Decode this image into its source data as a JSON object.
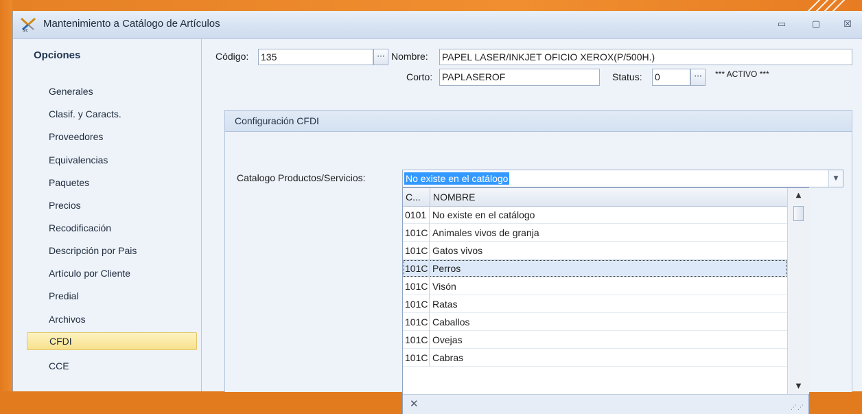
{
  "window": {
    "title": "Mantenimiento a Catálogo de Artículos",
    "buttons": {
      "minimize": "▭",
      "restore": "▢",
      "close": "☒"
    }
  },
  "sidebar": {
    "title": "Opciones",
    "items": [
      {
        "label": "Generales"
      },
      {
        "label": "Clasif. y Caracts."
      },
      {
        "label": "Proveedores"
      },
      {
        "label": "Equivalencias"
      },
      {
        "label": "Paquetes"
      },
      {
        "label": "Precios"
      },
      {
        "label": "Recodificación"
      },
      {
        "label": "Descripción por Pais"
      },
      {
        "label": "Artículo por Cliente"
      },
      {
        "label": "Predial"
      },
      {
        "label": "Archivos"
      },
      {
        "label": "CFDI",
        "active": true
      },
      {
        "label": "CCE"
      }
    ]
  },
  "form": {
    "codigo_label": "Código:",
    "codigo_value": "135",
    "nombre_label": "Nombre:",
    "nombre_value": "PAPEL LASER/INKJET OFICIO XEROX(P/500H.)",
    "corto_label": "Corto:",
    "corto_value": "PAPLASEROF",
    "status_label": "Status:",
    "status_value": "0",
    "status_text": "*** ACTIVO ***",
    "ellipsis": "···"
  },
  "cfdi": {
    "group_title": "Configuración CFDI",
    "catalog_label": "Catalogo Productos/Servicios:",
    "catalog_selected": "No existe en el catálogo",
    "columns": {
      "code": "C...",
      "name": "NOMBRE"
    },
    "rows": [
      {
        "code": "0101",
        "name": "No existe en el catálogo"
      },
      {
        "code": "101C",
        "name": "Animales vivos de granja"
      },
      {
        "code": "101C",
        "name": "Gatos vivos"
      },
      {
        "code": "101C",
        "name": "Perros",
        "highlighted": true
      },
      {
        "code": "101C",
        "name": "Visón"
      },
      {
        "code": "101C",
        "name": "Ratas"
      },
      {
        "code": "101C",
        "name": "Caballos"
      },
      {
        "code": "101C",
        "name": "Ovejas"
      },
      {
        "code": "101C",
        "name": "Cabras"
      }
    ],
    "clear_icon": "✕"
  },
  "colors": {
    "desktop": "#e27a1e",
    "active_item": "#f8e18d",
    "selection": "#3399ff",
    "row_highlight": "#dde9f8"
  }
}
